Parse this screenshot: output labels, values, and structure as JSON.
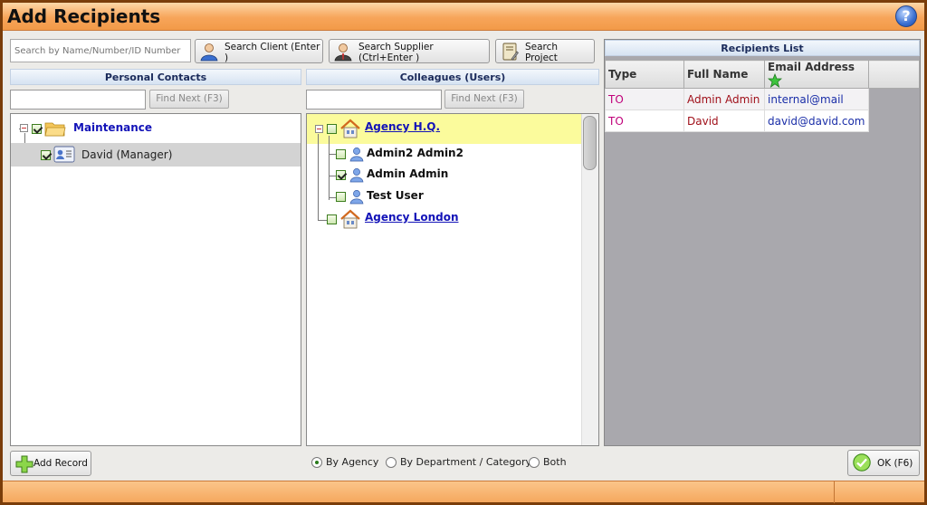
{
  "window": {
    "title": "Add Recipients"
  },
  "search": {
    "placeholder": "Search by Name/Number/ID Number",
    "value": "",
    "client_button": "Search Client  (Enter )",
    "supplier_button": "Search Supplier  (Ctrl+Enter )",
    "project_button": "Search Project"
  },
  "personal_contacts": {
    "header": "Personal Contacts",
    "find_value": "",
    "find_next": "Find Next  (F3)",
    "tree": [
      {
        "label": "Maintenance",
        "type": "folder",
        "checked": true,
        "expanded": true
      },
      {
        "label": "David (Manager)",
        "type": "contact",
        "checked": true,
        "selected": true
      }
    ]
  },
  "colleagues": {
    "header": "Colleagues (Users)",
    "find_value": "",
    "find_next": "Find Next  (F3)",
    "tree": [
      {
        "label": "Agency H.Q.",
        "type": "agency",
        "checked": false,
        "expanded": true,
        "selected": true
      },
      {
        "label": "Admin2 Admin2",
        "type": "user",
        "checked": false
      },
      {
        "label": "Admin Admin",
        "type": "user",
        "checked": true
      },
      {
        "label": "Test User",
        "type": "user",
        "checked": false
      },
      {
        "label": "Agency London",
        "type": "agency",
        "checked": false,
        "expanded": false
      }
    ]
  },
  "recipients": {
    "header": "Recipients List",
    "columns": [
      "Type",
      "Full Name",
      "Email Address"
    ],
    "rows": [
      {
        "type": "TO",
        "name": "Admin Admin",
        "email": "internal@mail"
      },
      {
        "type": "TO",
        "name": "David",
        "email": "david@david.com"
      }
    ]
  },
  "footer": {
    "add_record": "Add Record",
    "group_options": [
      "By Agency",
      "By Department / Category",
      "Both"
    ],
    "group_selected": "By Agency",
    "ok_button": "OK  (F6)"
  },
  "colors": {
    "title_bar": "#f7a55a",
    "type_text": "#c0007a",
    "name_text": "#a0101a",
    "email_text": "#1a2ea8",
    "link": "#1313b8"
  }
}
